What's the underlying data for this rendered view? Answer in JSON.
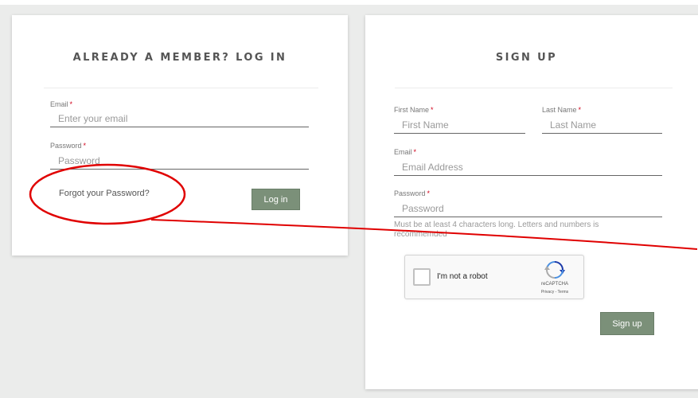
{
  "login": {
    "title": "ALREADY A MEMBER? LOG IN",
    "email_label": "Email",
    "email_placeholder": "Enter your email",
    "password_label": "Password",
    "password_placeholder": "Password",
    "forgot_link": "Forgot your Password?",
    "login_button": "Log in"
  },
  "signup": {
    "title": "SIGN UP",
    "first_name_label": "First Name",
    "first_name_placeholder": "First Name",
    "last_name_label": "Last Name",
    "last_name_placeholder": "Last Name",
    "email_label": "Email",
    "email_placeholder": "Email Address",
    "password_label": "Password",
    "password_placeholder": "Password",
    "password_hint": "Must be at least 4 characters long. Letters and numbers is recommemded",
    "signup_button": "Sign up"
  },
  "recaptcha": {
    "label": "I'm not a robot",
    "brand": "reCAPTCHA",
    "terms": "Privacy - Terms",
    "icon": "recaptcha-logo-icon"
  },
  "required_mark": "*",
  "colors": {
    "accent_button": "#7b9079",
    "required": "#d0021b",
    "annotation": "#e00000",
    "background": "#ebeceb"
  }
}
